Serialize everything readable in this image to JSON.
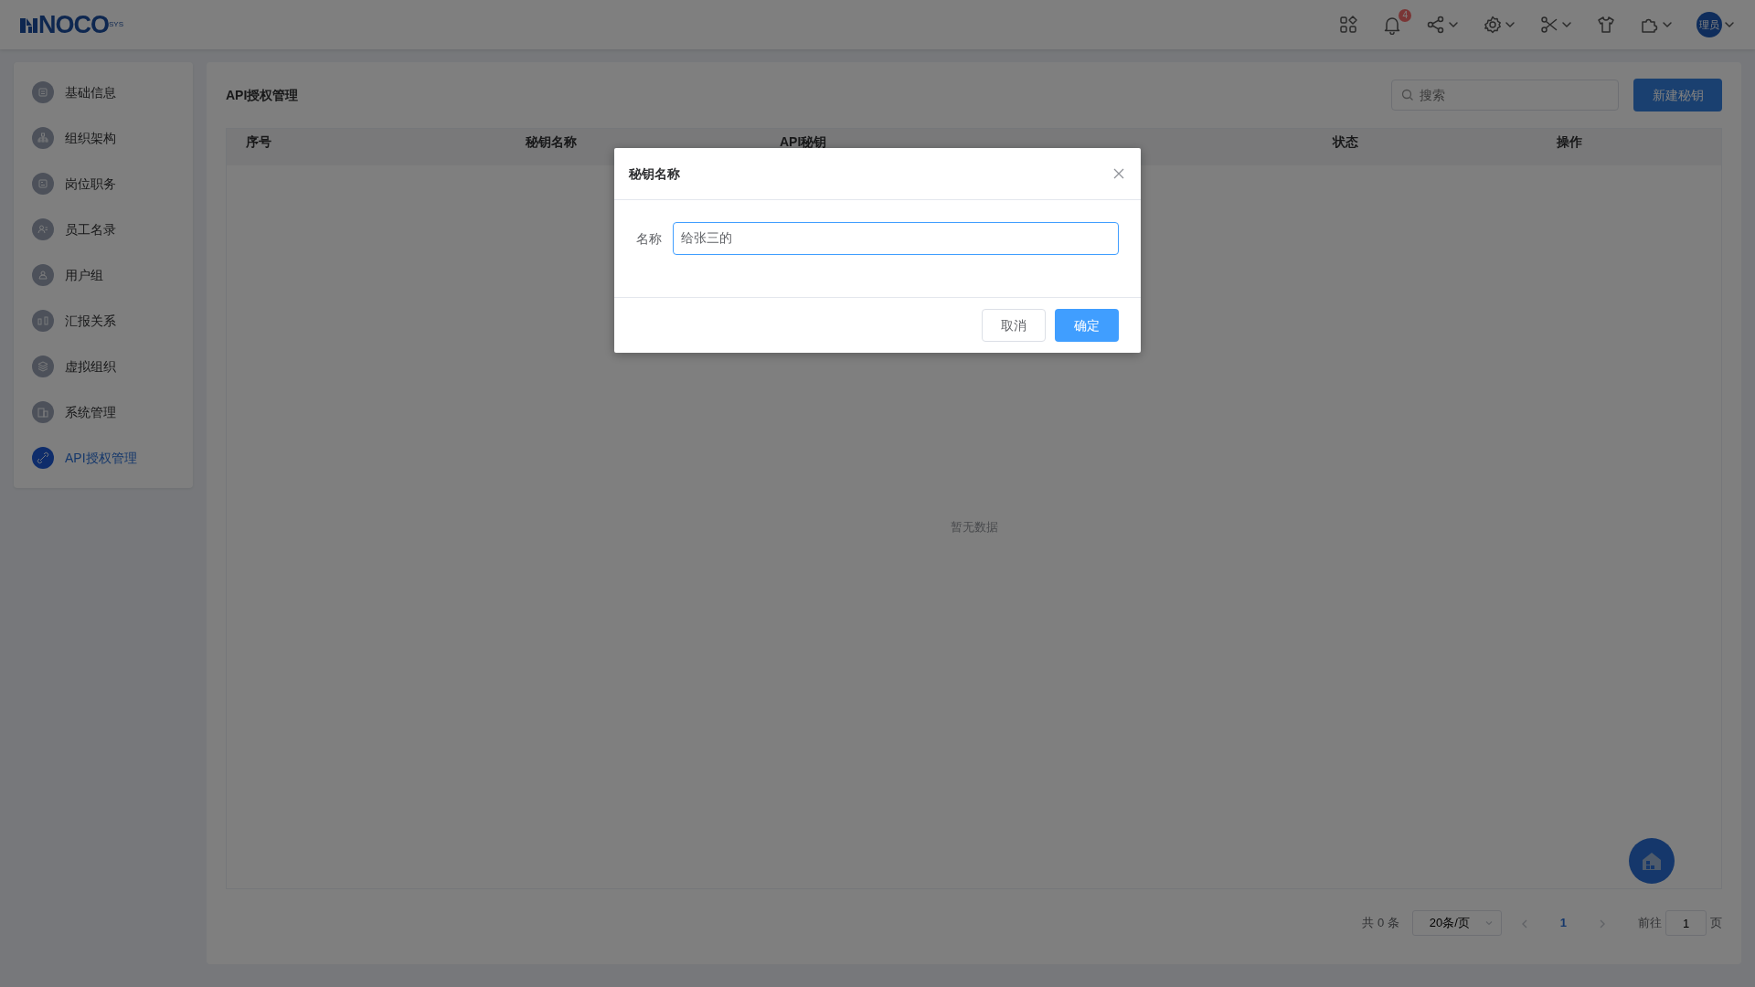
{
  "header": {
    "logo": "NOCO",
    "logo_sup": "SYS",
    "notification_count": "4",
    "avatar_text": "理员"
  },
  "sidebar": {
    "items": [
      {
        "label": "基础信息",
        "selected": false
      },
      {
        "label": "组织架构",
        "selected": false
      },
      {
        "label": "岗位职务",
        "selected": false
      },
      {
        "label": "员工名录",
        "selected": false
      },
      {
        "label": "用户组",
        "selected": false
      },
      {
        "label": "汇报关系",
        "selected": false
      },
      {
        "label": "虚拟组织",
        "selected": false
      },
      {
        "label": "系统管理",
        "selected": false
      },
      {
        "label": "API授权管理",
        "selected": true
      }
    ]
  },
  "main": {
    "title": "API授权管理",
    "search": {
      "placeholder": "搜索"
    },
    "new_button": "新建秘钥",
    "table": {
      "columns": [
        "序号",
        "秘钥名称",
        "API秘钥",
        "状态",
        "操作"
      ],
      "empty_text": "暂无数据"
    },
    "pagination": {
      "total": "共 0 条",
      "page_size": "20条/页",
      "current_page": "1",
      "goto_label": "前往",
      "goto_value": "1",
      "page_unit": "页"
    }
  },
  "dialog": {
    "title": "秘钥名称",
    "field_label": "名称",
    "field_value": "给张三的",
    "cancel": "取消",
    "confirm": "确定"
  }
}
